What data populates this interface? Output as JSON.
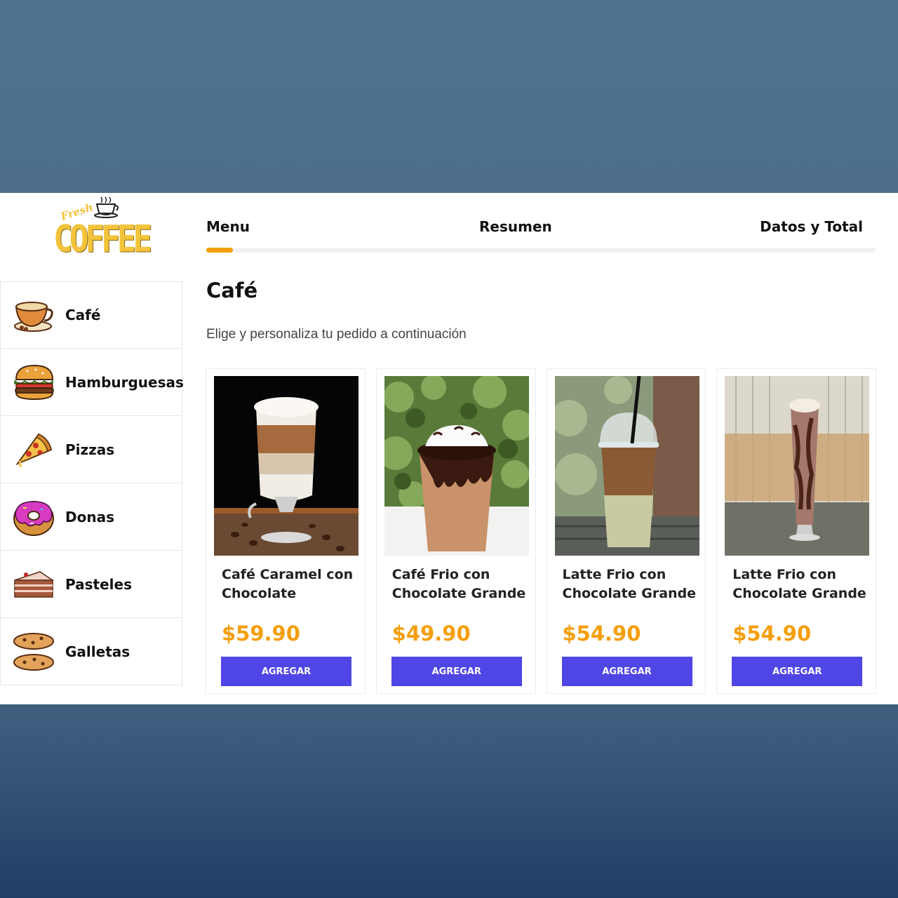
{
  "logo": {
    "script": "Fresh",
    "word": "COFFEE"
  },
  "steps": [
    {
      "label": "Menu"
    },
    {
      "label": "Resumen"
    },
    {
      "label": "Datos y Total"
    }
  ],
  "progress": {
    "fraction": 0.04,
    "color": "#f59e0b"
  },
  "sidebar": {
    "items": [
      {
        "label": "Café",
        "icon": "coffee-cup-icon",
        "active": true
      },
      {
        "label": "Hamburguesas",
        "icon": "burger-icon",
        "active": false
      },
      {
        "label": "Pizzas",
        "icon": "pizza-slice-icon",
        "active": false
      },
      {
        "label": "Donas",
        "icon": "donut-icon",
        "active": false
      },
      {
        "label": "Pasteles",
        "icon": "cake-slice-icon",
        "active": false
      },
      {
        "label": "Galletas",
        "icon": "cookies-icon",
        "active": false
      }
    ]
  },
  "main": {
    "title": "Café",
    "subtitle": "Elige y personaliza tu pedido a continuación"
  },
  "products": [
    {
      "name": "Café Caramel con Chocolate",
      "price": "$59.90",
      "button": "AGREGAR",
      "photo": "layered-latte-glass-photo"
    },
    {
      "name": "Café Frio con Chocolate Grande",
      "price": "$49.90",
      "button": "AGREGAR",
      "photo": "chocolate-frappe-cup-photo"
    },
    {
      "name": "Latte Frio con Chocolate Grande",
      "price": "$54.90",
      "button": "AGREGAR",
      "photo": "iced-latte-dome-cup-photo"
    },
    {
      "name": "Latte Frio con Chocolate Grande",
      "price": "$54.90",
      "button": "AGREGAR",
      "photo": "chocolate-milkshake-glass-photo"
    }
  ],
  "colors": {
    "accent": "#fbbf24",
    "price": "#f59e0b",
    "button": "#4f46e5"
  }
}
